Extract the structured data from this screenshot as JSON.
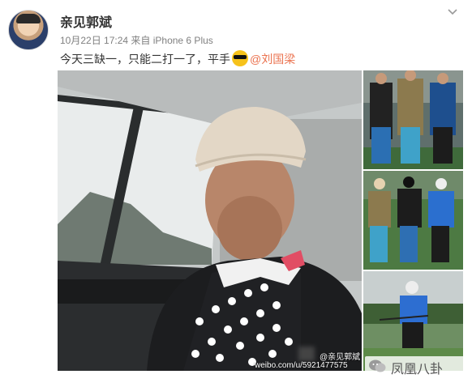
{
  "post": {
    "username": "亲见郭斌",
    "meta": "10月22日 17:24 来自 iPhone 6 Plus",
    "text_before": "今天三缺一，只能二打一了，平手",
    "mention": "@刘国梁"
  },
  "icons": {
    "more": "chevron-down-icon",
    "emoji": "sunglasses-emoji-icon",
    "brand_logo": "wechat-bubble-icon"
  },
  "watermark": {
    "url": "weibo.com/u/5921477575",
    "name": "@亲见郭斌",
    "brand": "凤凰八卦"
  },
  "colors": {
    "mention": "#eb7350",
    "username": "#333333",
    "meta": "#808080"
  }
}
